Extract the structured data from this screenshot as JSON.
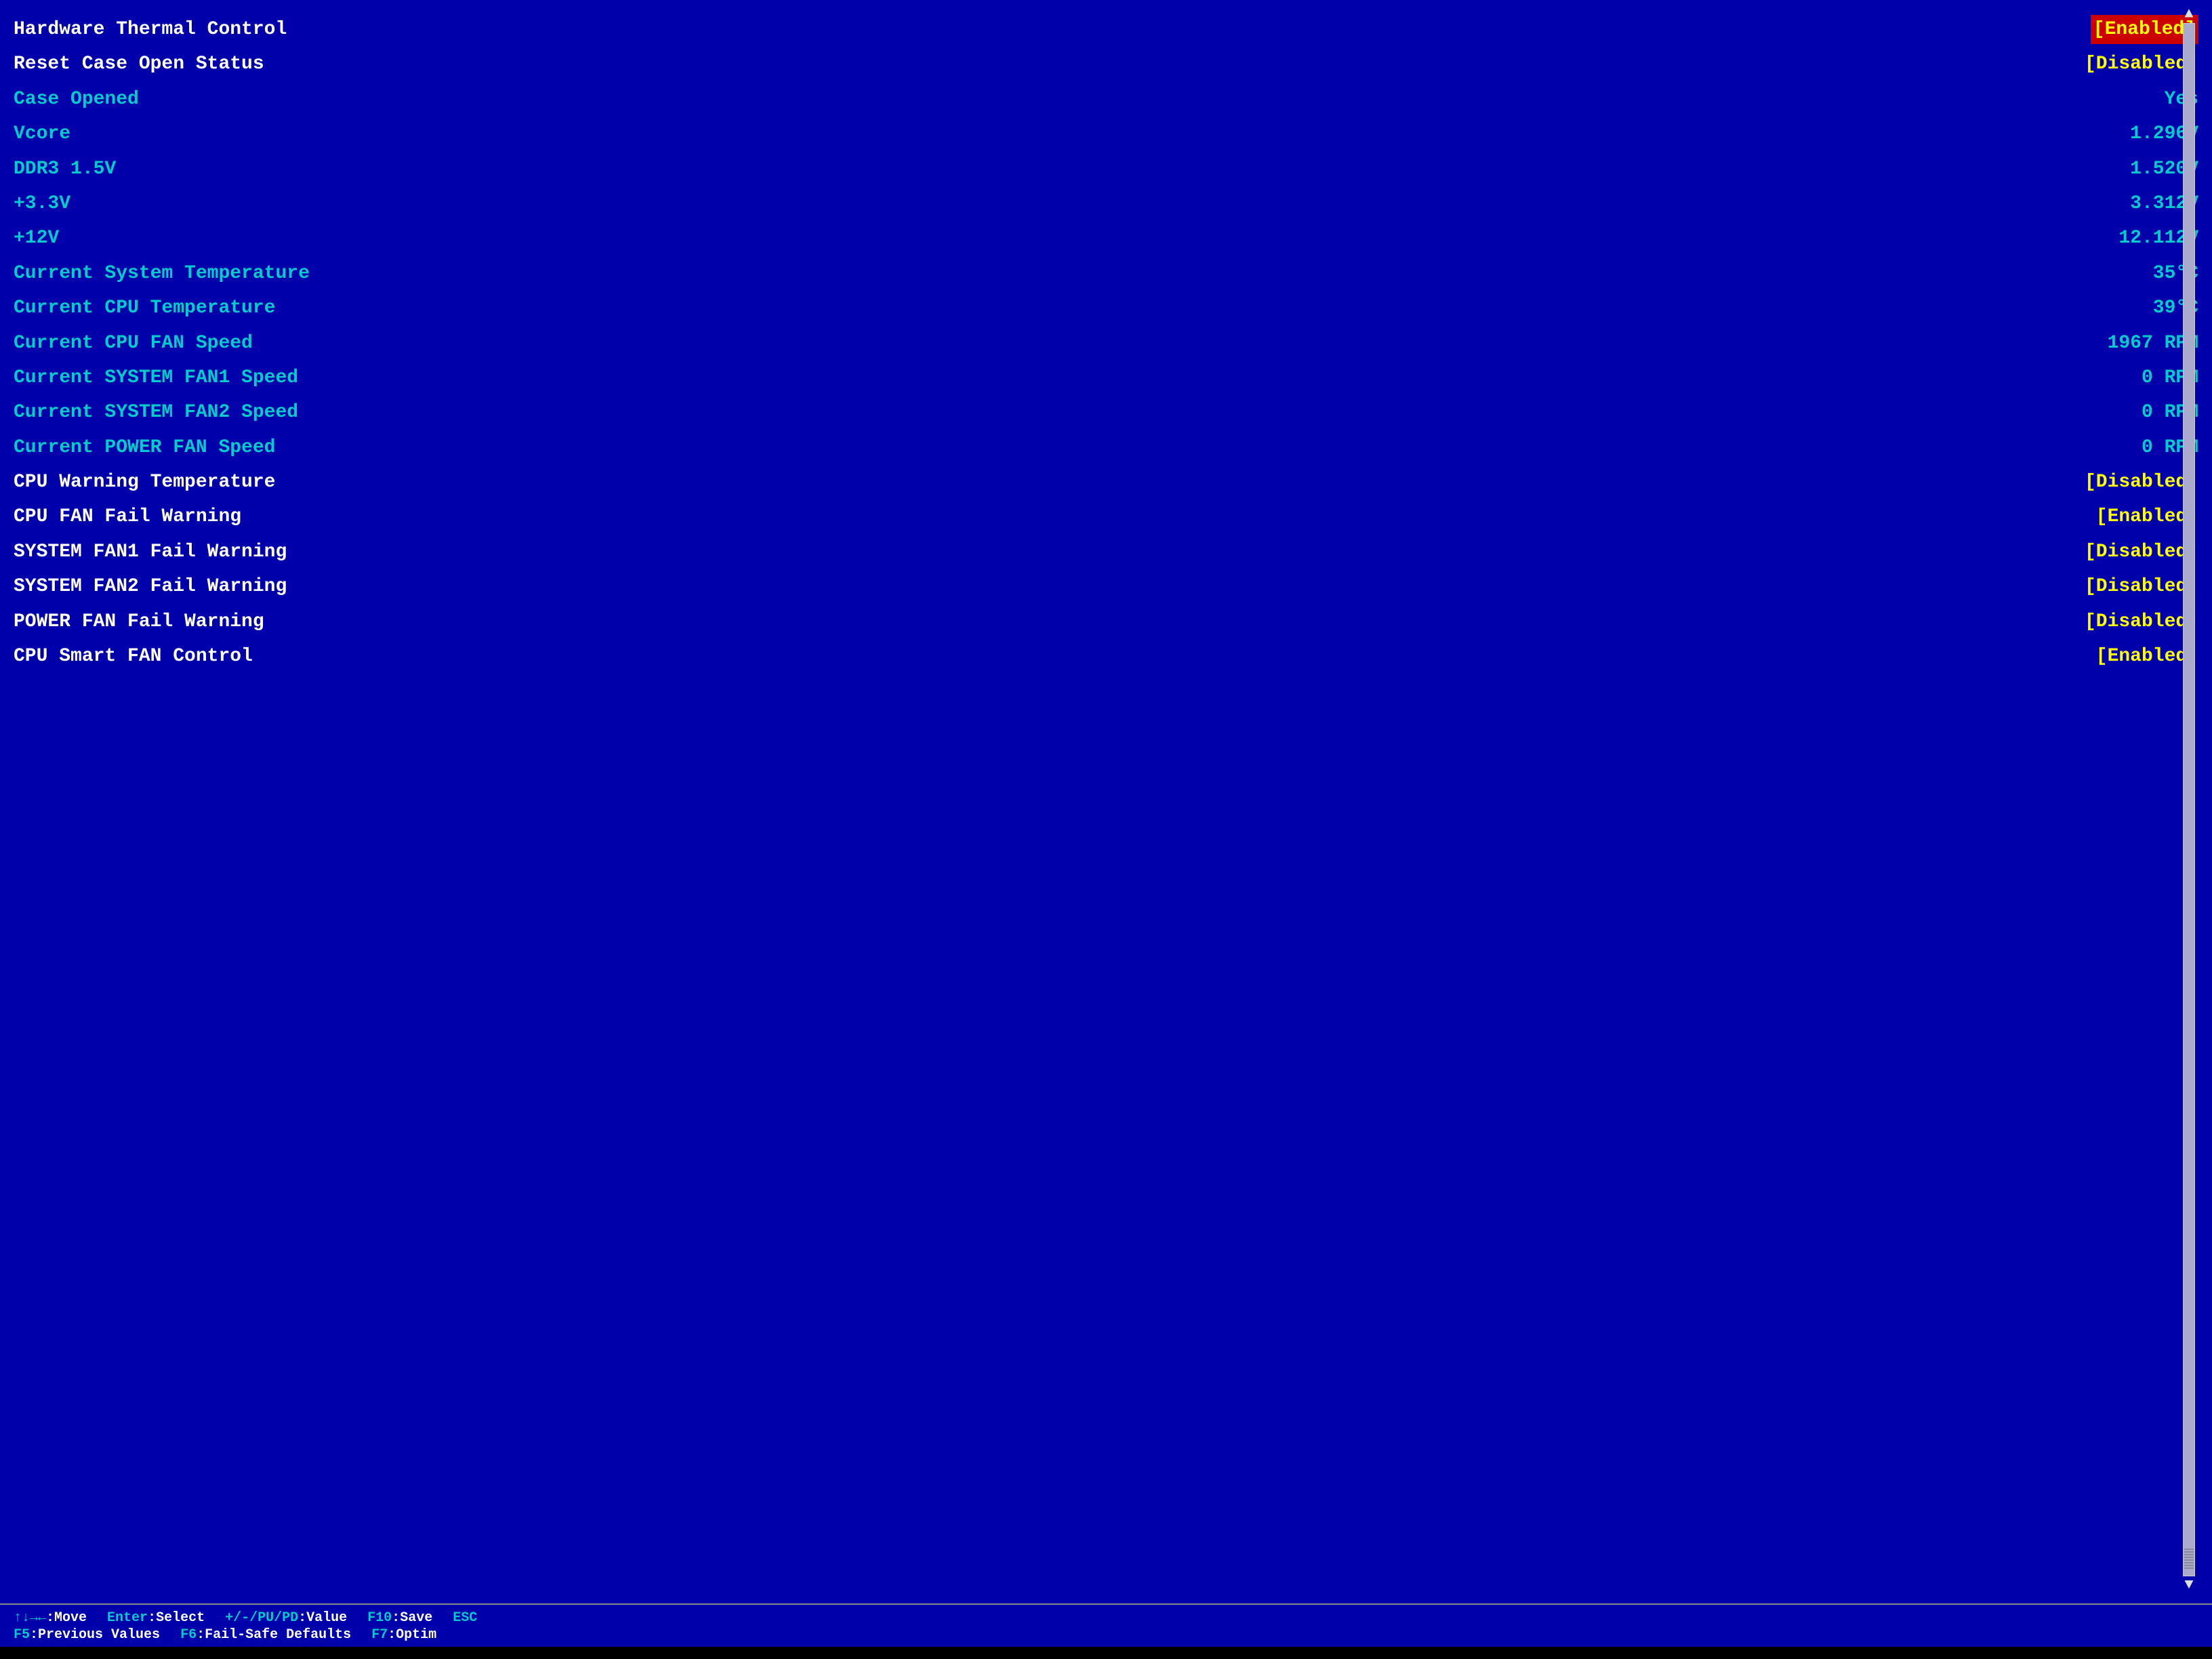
{
  "bios": {
    "rows": [
      {
        "id": "hardware-thermal-control",
        "label": "Hardware Thermal Control",
        "value": "[Enabled]",
        "labelColor": "white",
        "valueColor": "yellow-highlight"
      },
      {
        "id": "reset-case-open-status",
        "label": "Reset Case Open Status",
        "value": "[Disabled]",
        "labelColor": "white",
        "valueColor": "yellow"
      },
      {
        "id": "case-opened",
        "label": "Case Opened",
        "value": "Yes",
        "labelColor": "cyan",
        "valueColor": "cyan"
      },
      {
        "id": "vcore",
        "label": "Vcore",
        "value": "1.296V",
        "labelColor": "cyan",
        "valueColor": "cyan"
      },
      {
        "id": "ddr3-1-5v",
        "label": "DDR3 1.5V",
        "value": "1.520V",
        "labelColor": "cyan",
        "valueColor": "cyan"
      },
      {
        "id": "plus-3-3v",
        "label": "+3.3V",
        "value": "3.312V",
        "labelColor": "cyan",
        "valueColor": "cyan"
      },
      {
        "id": "plus-12v",
        "label": "+12V",
        "value": "12.112V",
        "labelColor": "cyan",
        "valueColor": "cyan"
      },
      {
        "id": "current-system-temperature",
        "label": "Current System Temperature",
        "value": "35°C",
        "labelColor": "cyan",
        "valueColor": "cyan"
      },
      {
        "id": "current-cpu-temperature",
        "label": "Current CPU Temperature",
        "value": "39°C",
        "labelColor": "cyan",
        "valueColor": "cyan"
      },
      {
        "id": "current-cpu-fan-speed",
        "label": "Current CPU FAN Speed",
        "value": "1967 RPM",
        "labelColor": "cyan",
        "valueColor": "cyan"
      },
      {
        "id": "current-system-fan1-speed",
        "label": "Current SYSTEM FAN1 Speed",
        "value": "0 RPM",
        "labelColor": "cyan",
        "valueColor": "cyan"
      },
      {
        "id": "current-system-fan2-speed",
        "label": "Current SYSTEM FAN2 Speed",
        "value": "0 RPM",
        "labelColor": "cyan",
        "valueColor": "cyan"
      },
      {
        "id": "current-power-fan-speed",
        "label": "Current POWER FAN Speed",
        "value": "0 RPM",
        "labelColor": "cyan",
        "valueColor": "cyan"
      },
      {
        "id": "cpu-warning-temperature",
        "label": "CPU Warning Temperature",
        "value": "[Disabled]",
        "labelColor": "white",
        "valueColor": "yellow"
      },
      {
        "id": "cpu-fan-fail-warning",
        "label": "CPU FAN Fail Warning",
        "value": "[Enabled]",
        "labelColor": "white",
        "valueColor": "yellow"
      },
      {
        "id": "system-fan1-fail-warning",
        "label": "SYSTEM FAN1 Fail Warning",
        "value": "[Disabled]",
        "labelColor": "white",
        "valueColor": "yellow"
      },
      {
        "id": "system-fan2-fail-warning",
        "label": "SYSTEM FAN2 Fail Warning",
        "value": "[Disabled]",
        "labelColor": "white",
        "valueColor": "yellow"
      },
      {
        "id": "power-fan-fail-warning",
        "label": "POWER FAN Fail Warning",
        "value": "[Disabled]",
        "labelColor": "white",
        "valueColor": "yellow"
      },
      {
        "id": "cpu-smart-fan-control",
        "label": "CPU Smart FAN Control",
        "value": "[Enabled]",
        "labelColor": "white",
        "valueColor": "yellow"
      }
    ],
    "footer": {
      "row1": [
        {
          "key": "↑↓→←",
          "colon": ":",
          "action": "Move"
        },
        {
          "key": "Enter",
          "colon": ":",
          "action": "Select"
        },
        {
          "key": "+/-/PU/PD",
          "colon": ":",
          "action": "Value"
        },
        {
          "key": "F10",
          "colon": ":",
          "action": "Save"
        },
        {
          "key": "ESC",
          "colon": "",
          "action": ""
        }
      ],
      "row2": [
        {
          "key": "F5",
          "colon": ":",
          "action": "Previous Values"
        },
        {
          "key": "F6",
          "colon": ":",
          "action": "Fail-Safe Defaults"
        },
        {
          "key": "F7",
          "colon": ":",
          "action": "Optim"
        }
      ]
    }
  }
}
